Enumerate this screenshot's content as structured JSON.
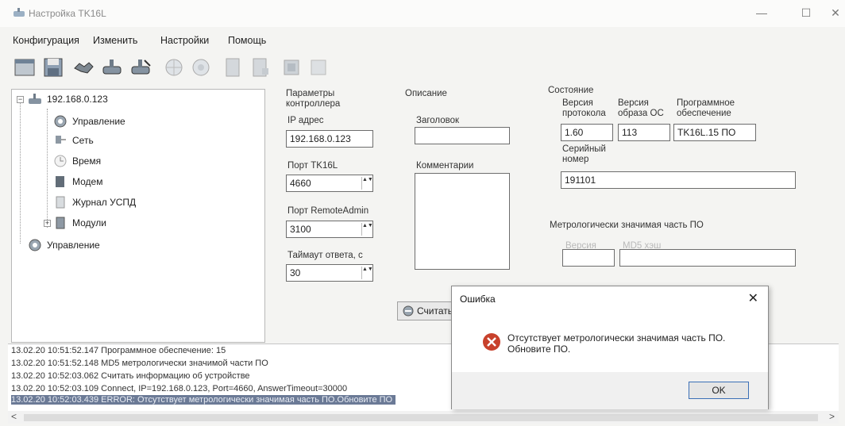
{
  "window": {
    "title": "Настройка TK16L",
    "controls": {
      "minimize": "—",
      "maximize": "☐",
      "close": "✕"
    }
  },
  "menu": [
    "Конфигурация",
    "Изменить",
    "Настройки",
    "Помощь"
  ],
  "toolbar": {
    "icons": [
      "window-icon",
      "save-icon",
      "handshake-icon",
      "connect-icon",
      "disconnect-icon",
      "globe-icon",
      "globe-settings-icon",
      "device-icon",
      "device-config-icon",
      "module-icon",
      "module-config-icon"
    ]
  },
  "tree": {
    "root": "192.168.0.123",
    "children": [
      "Управление",
      "Сеть",
      "Время",
      "Модем",
      "Журнал УСПД",
      "Модули"
    ],
    "root2": "Управление",
    "expander_minus": "−",
    "expander_plus": "+"
  },
  "controller": {
    "header": "Параметры контроллера",
    "ip_label": "IP адрес",
    "ip_value": "192.168.0.123",
    "port_label": "Порт TK16L",
    "port_value": "4660",
    "remote_label": "Порт RemoteAdmin",
    "remote_value": "3100",
    "timeout_label": "Таймаут ответа, с",
    "timeout_value": "30",
    "spin_arrows": "▲▼"
  },
  "description": {
    "header": "Описание",
    "title_label": "Заголовок",
    "title_value": "",
    "comments_label": "Комментарии",
    "read_button": "Считать"
  },
  "state": {
    "header": "Состояние",
    "protocol_label": "Версия протокола",
    "protocol_value": "1.60",
    "os_label": "Версия образа ОС",
    "os_value": "113",
    "software_label": "Программное обеспечение",
    "software_value": "TK16L.15 ПО",
    "serial_label": "Серийный номер",
    "serial_value": "191101",
    "metro_header": "Метрологически значимая часть ПО",
    "metro_version_label": "Версия",
    "metro_hash_label": "MD5 хэш",
    "metro_version_value": "",
    "metro_hash_value": ""
  },
  "log": [
    "13.02.20 10:51:52.147 Программное обеспечение: 15",
    "13.02.20 10:51:52.148 MD5 метрологически значимой части ПО",
    "13.02.20 10:52:03.062 Считать информацию об устройстве",
    "13.02.20 10:52:03.109 Connect, IP=192.168.0.123, Port=4660, AnswerTimeout=30000",
    "13.02.20 10:52:03.439 ERROR: Отсутствует метрологически значимая часть ПО.Обновите ПО"
  ],
  "scroll": {
    "left": "<",
    "right": ">"
  },
  "dialog": {
    "title": "Ошибка",
    "close": "✕",
    "message": "Отсутствует метрологически значимая часть ПО. Обновите ПО.",
    "ok": "OK"
  },
  "colors": {
    "selection": "#6b7a96",
    "error_icon": "#c8412c",
    "ok_border": "#3b6fb6"
  }
}
